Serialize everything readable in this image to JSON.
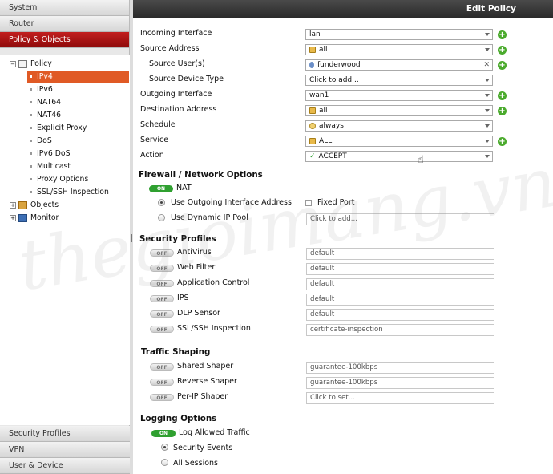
{
  "sidebar": {
    "top_sections": [
      {
        "label": "System"
      },
      {
        "label": "Router"
      },
      {
        "label": "Policy & Objects"
      }
    ],
    "tree": {
      "policy": "Policy",
      "items": [
        "IPv4",
        "IPv6",
        "NAT64",
        "NAT46",
        "Explicit Proxy",
        "DoS",
        "IPv6 DoS",
        "Multicast",
        "Proxy Options",
        "SSL/SSH Inspection"
      ],
      "objects": "Objects",
      "monitor": "Monitor"
    },
    "bottom_sections": [
      {
        "label": "Security Profiles"
      },
      {
        "label": "VPN"
      },
      {
        "label": "User & Device"
      }
    ]
  },
  "header": {
    "title": "Edit Policy"
  },
  "form": {
    "incoming_interface": {
      "label": "Incoming Interface",
      "value": "lan"
    },
    "source_address": {
      "label": "Source Address",
      "value": "all"
    },
    "source_users": {
      "label": "Source User(s)",
      "value": "funderwood"
    },
    "source_device_type": {
      "label": "Source Device Type",
      "value": "Click to add..."
    },
    "outgoing_interface": {
      "label": "Outgoing Interface",
      "value": "wan1"
    },
    "destination_address": {
      "label": "Destination Address",
      "value": "all"
    },
    "schedule": {
      "label": "Schedule",
      "value": "always"
    },
    "service": {
      "label": "Service",
      "value": "ALL"
    },
    "action": {
      "label": "Action",
      "value": "ACCEPT"
    }
  },
  "firewall": {
    "title": "Firewall / Network Options",
    "nat_label": "NAT",
    "nat_toggle": "ON",
    "use_outgoing": "Use Outgoing Interface Address",
    "fixed_port": "Fixed Port",
    "use_dynamic": "Use Dynamic IP Pool",
    "pool_placeholder": "Click to add..."
  },
  "security_profiles": {
    "title": "Security Profiles",
    "toggle_label": "OFF",
    "items": [
      {
        "label": "AntiVirus",
        "value": "default"
      },
      {
        "label": "Web Filter",
        "value": "default"
      },
      {
        "label": "Application Control",
        "value": "default"
      },
      {
        "label": "IPS",
        "value": "default"
      },
      {
        "label": "DLP Sensor",
        "value": "default"
      },
      {
        "label": "SSL/SSH Inspection",
        "value": "certificate-inspection"
      }
    ]
  },
  "traffic_shaping": {
    "title": "Traffic Shaping",
    "toggle_label": "OFF",
    "items": [
      {
        "label": "Shared Shaper",
        "value": "guarantee-100kbps"
      },
      {
        "label": "Reverse Shaper",
        "value": "guarantee-100kbps"
      },
      {
        "label": "Per-IP Shaper",
        "value": "Click to set..."
      }
    ]
  },
  "logging": {
    "title": "Logging Options",
    "toggle_label": "ON",
    "log_allowed": "Log Allowed Traffic",
    "security_events": "Security Events",
    "all_sessions": "All Sessions"
  },
  "watermark": "thegioimang.vn",
  "colors": {
    "accent_red": "#a31414",
    "selection_orange": "#e05a25",
    "toggle_green": "#2fa030",
    "add_green": "#4aaa2c"
  }
}
